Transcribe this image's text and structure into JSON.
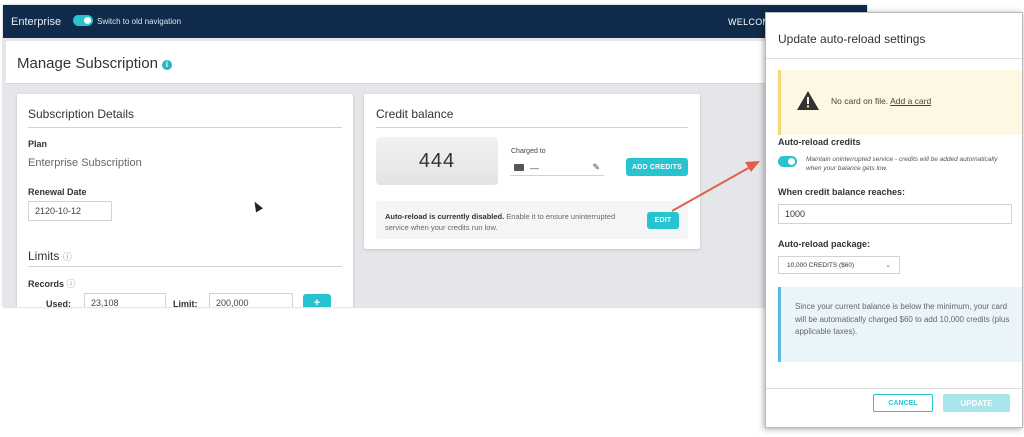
{
  "topbar": {
    "brand": "Enterprise",
    "nav_switch_label": "Switch to old navigation",
    "welcome": "WELCOM"
  },
  "page": {
    "title": "Manage Subscription"
  },
  "subscription": {
    "heading": "Subscription Details",
    "plan_label": "Plan",
    "plan_value": "Enterprise Subscription",
    "renewal_label": "Renewal Date",
    "renewal_value": "2120-10-12",
    "limits_heading": "Limits",
    "records_label": "Records",
    "used_label": "Used:",
    "used_value": "23,108",
    "limit_label": "Limit:",
    "limit_value": "200,000",
    "add_button": "+"
  },
  "credit": {
    "heading": "Credit balance",
    "balance": "444",
    "charged_to_label": "Charged to",
    "charged_to_value": "—",
    "add_credits_button": "ADD CREDITS",
    "notice_bold": "Auto-reload is currently disabled.",
    "notice_rest": " Enable it to ensure uninterrupted service when your credits run low.",
    "edit_button": "EDIT"
  },
  "modal": {
    "title": "Update auto-reload settings",
    "warning_text": "No card on file.",
    "warning_link": "Add a card",
    "auto_reload_label": "Auto-reload credits",
    "auto_reload_desc": "Maintain uninterrupted service - credits will be added automatically when your balance gets low.",
    "threshold_label": "When credit balance reaches:",
    "threshold_value": "1000",
    "package_label": "Auto-reload package:",
    "package_value": "10,000 CREDITS ($60)",
    "info_text": "Since your current balance is below the minimum, your card will be automatically charged $60 to add 10,000 credits (plus applicable taxes).",
    "cancel_button": "CANCEL",
    "update_button": "UPDATE"
  },
  "colors": {
    "accent": "#27c4d0",
    "topbar": "#0f2a4a",
    "arrow": "#e0604a"
  }
}
